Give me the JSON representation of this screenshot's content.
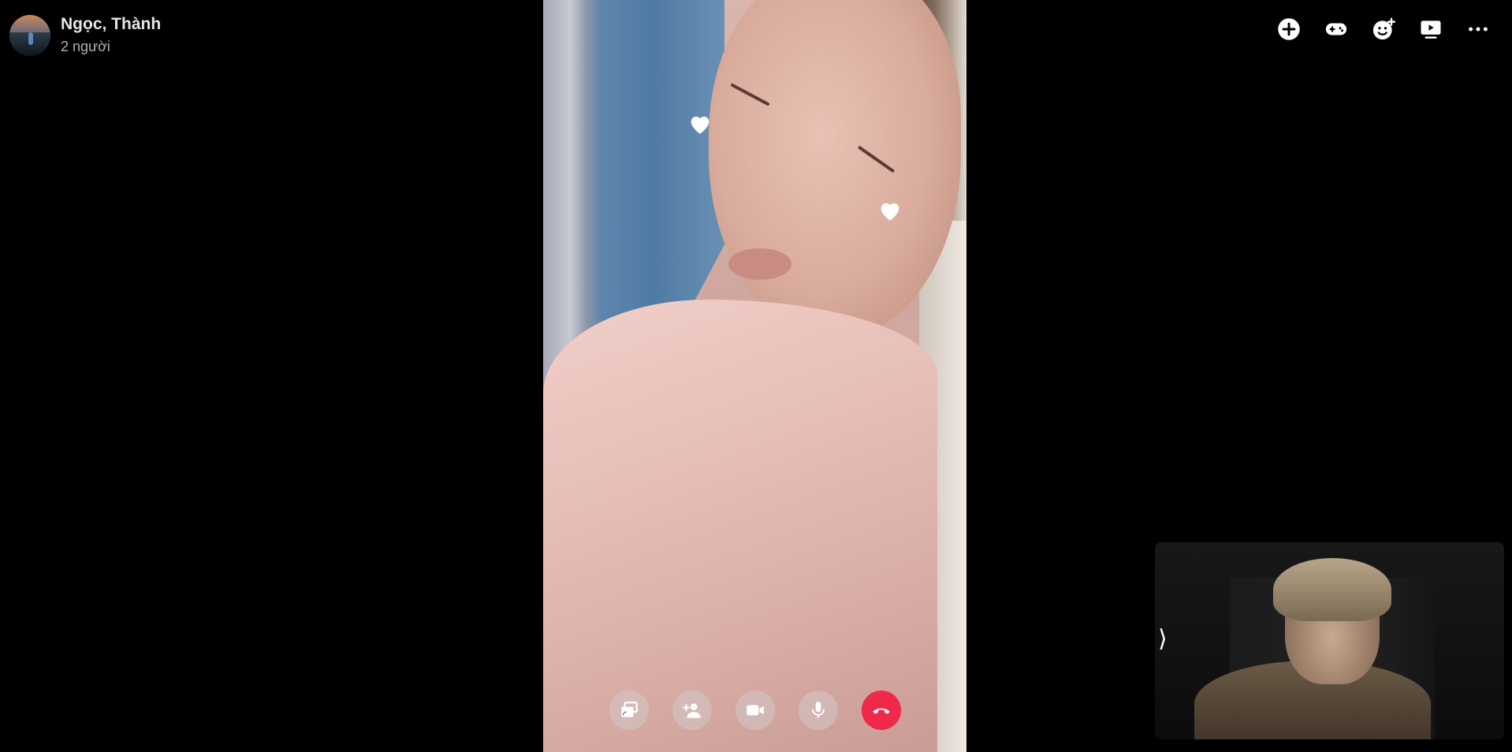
{
  "header": {
    "title": "Ngọc, Thành",
    "subtitle": "2 người"
  },
  "top_actions": [
    {
      "name": "add-icon"
    },
    {
      "name": "game-icon"
    },
    {
      "name": "add-emoji-icon"
    },
    {
      "name": "watch-together-icon"
    },
    {
      "name": "more-icon"
    }
  ],
  "call_controls": [
    {
      "name": "share-screen-icon"
    },
    {
      "name": "add-person-icon"
    },
    {
      "name": "video-camera-icon"
    },
    {
      "name": "microphone-icon"
    },
    {
      "name": "end-call-icon"
    }
  ],
  "self_view": {
    "collapse_glyph": "⟩"
  },
  "colors": {
    "background": "#000000",
    "end_call": "#f02849",
    "text_primary": "#e4e6eb",
    "text_secondary": "#b0b3b8"
  }
}
